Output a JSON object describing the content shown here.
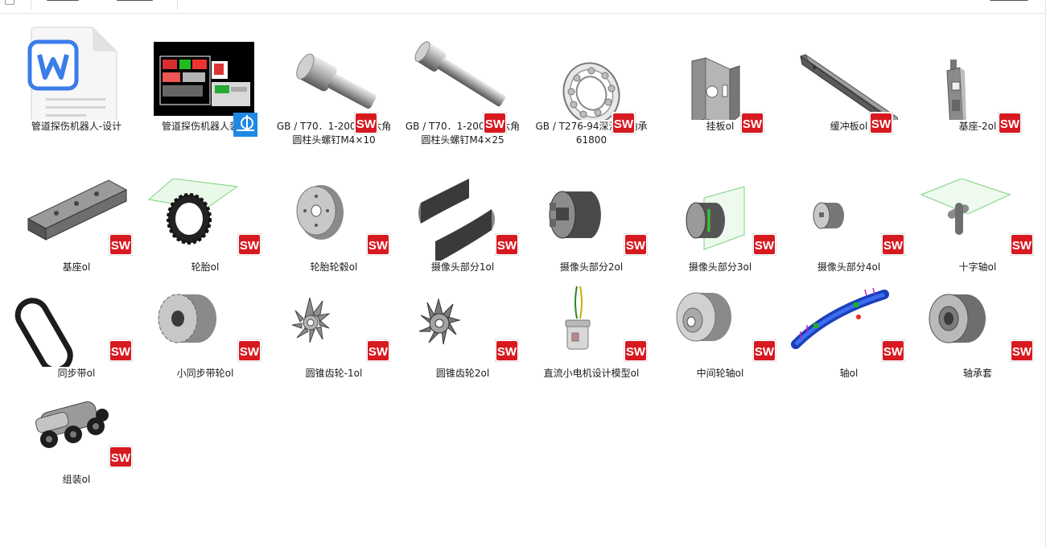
{
  "files": [
    {
      "name": "管道探伤机器人-设计",
      "kind": "wps-doc",
      "icon": "wps-writer-icon"
    },
    {
      "name": "管道探伤机器人装配",
      "kind": "cad",
      "icon": "cad-drawing-thumbnail"
    },
    {
      "name": "GB / T70．1-2000内六角圆柱头螺钉M4×10",
      "kind": "sw",
      "icon": "short-socket-screw-thumbnail"
    },
    {
      "name": "GB / T70．1-2000内六角圆柱头螺钉M4×25",
      "kind": "sw",
      "icon": "long-socket-screw-thumbnail"
    },
    {
      "name": "GB / T276-94深沟球轴承61800",
      "kind": "sw",
      "icon": "ball-bearing-thumbnail"
    },
    {
      "name": "挂板ol",
      "kind": "sw",
      "icon": "bracket-plate-thumbnail"
    },
    {
      "name": "缓冲板ol",
      "kind": "sw",
      "icon": "buffer-plate-thumbnail"
    },
    {
      "name": "基座-2ol",
      "kind": "sw",
      "icon": "base2-thumbnail"
    },
    {
      "name": "基座ol",
      "kind": "sw",
      "icon": "base-channel-thumbnail"
    },
    {
      "name": "轮胎ol",
      "kind": "sw",
      "icon": "tire-thumbnail"
    },
    {
      "name": "轮胎轮毂ol",
      "kind": "sw",
      "icon": "wheel-hub-thumbnail"
    },
    {
      "name": "摄像头部分1ol",
      "kind": "sw",
      "icon": "camera-part1-thumbnail"
    },
    {
      "name": "摄像头部分2ol",
      "kind": "sw",
      "icon": "camera-part2-thumbnail"
    },
    {
      "name": "摄像头部分3ol",
      "kind": "sw",
      "icon": "camera-part3-thumbnail"
    },
    {
      "name": "摄像头部分4ol",
      "kind": "sw",
      "icon": "camera-part4-thumbnail"
    },
    {
      "name": "十字轴ol",
      "kind": "sw",
      "icon": "cross-shaft-thumbnail"
    },
    {
      "name": "同步带ol",
      "kind": "sw",
      "icon": "timing-belt-thumbnail"
    },
    {
      "name": "小同步带轮ol",
      "kind": "sw",
      "icon": "small-pulley-thumbnail"
    },
    {
      "name": "圆锥齿轮-1ol",
      "kind": "sw",
      "icon": "bevel-gear1-thumbnail"
    },
    {
      "name": "圆锥齿轮2ol",
      "kind": "sw",
      "icon": "bevel-gear2-thumbnail"
    },
    {
      "name": "直流小电机设计模型ol",
      "kind": "sw",
      "icon": "dc-motor-thumbnail"
    },
    {
      "name": "中间轮轴ol",
      "kind": "sw",
      "icon": "middle-axle-thumbnail"
    },
    {
      "name": "轴ol",
      "kind": "sw",
      "icon": "shaft-fea-thumbnail"
    },
    {
      "name": "轴承套",
      "kind": "sw",
      "icon": "bearing-sleeve-thumbnail"
    },
    {
      "name": "组装ol",
      "kind": "sw",
      "icon": "assembly-robot-thumbnail"
    }
  ],
  "colors": {
    "sw_red": "#d71920",
    "wps_blue": "#3b7de9",
    "cad_blue": "#1e88e5",
    "part_gray": "#8a8a8a"
  }
}
